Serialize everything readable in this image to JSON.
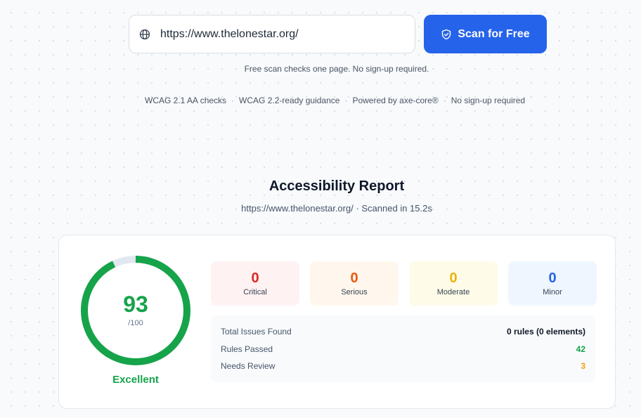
{
  "scan": {
    "url_value": "https://www.thelonestar.org/",
    "button_label": "Scan for Free",
    "note": "Free scan checks one page. No sign-up required."
  },
  "features": [
    "WCAG 2.1 AA checks",
    "WCAG 2.2-ready guidance",
    "Powered by axe-core®",
    "No sign-up required"
  ],
  "report": {
    "title": "Accessibility Report",
    "subtitle": "https://www.thelonestar.org/ · Scanned in 15.2s"
  },
  "score": {
    "value": "93",
    "max": "/100",
    "rating": "Excellent",
    "fraction": 0.93,
    "color": "#16a34a",
    "track_color": "#e2e8f0"
  },
  "counts": [
    {
      "value": "0",
      "label": "Critical",
      "color": "#dc2626",
      "bg": "#fef2f2"
    },
    {
      "value": "0",
      "label": "Serious",
      "color": "#ea580c",
      "bg": "#fff7ed"
    },
    {
      "value": "0",
      "label": "Moderate",
      "color": "#eab308",
      "bg": "#fefce8"
    },
    {
      "value": "0",
      "label": "Minor",
      "color": "#2563eb",
      "bg": "#eff6ff"
    }
  ],
  "summary": [
    {
      "label": "Total Issues Found",
      "value": "0 rules (0 elements)",
      "color": "#111827"
    },
    {
      "label": "Rules Passed",
      "value": "42",
      "color": "#16a34a"
    },
    {
      "label": "Needs Review",
      "value": "3",
      "color": "#f59e0b"
    }
  ],
  "icons": {
    "url": "globe-icon",
    "button": "shield-check-icon"
  }
}
